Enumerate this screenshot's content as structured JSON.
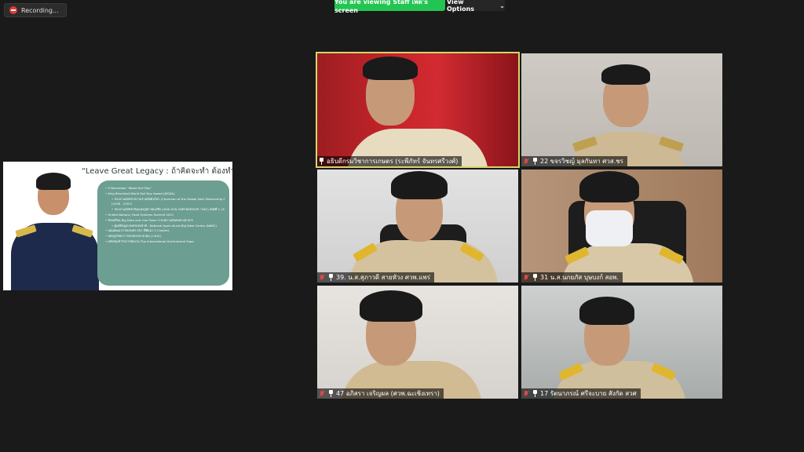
{
  "recording": {
    "label": "Recording..."
  },
  "banner": {
    "viewing": "You are viewing Staff เพ็ด's screen",
    "view_options": "View Options",
    "chevron": "⌄"
  },
  "shared_screen": {
    "title": "“Leave Great Legacy : ถ้าคิดจะทำ ต้องทำให้สุด”",
    "items": [
      "• 5 December \"World Soil Day\"",
      "• King Bhumibol World Soil Day Award (WSDA)",
      "• ประธานสมัชชาความร่วมมือดินโลก (Chairman of the Global Soils Partnership Assembly: FAO/ United Nations)",
      "  (2556 - 2557)",
      "• ประธานสมัชชาดินแห่งภูมิภาคเอเชีย (ASIA SOIL PARTNERSHIP / FAO) สมัยที่ 1 (2556 - 2560) และสมัยที่ 2 (2561 - 2562)",
      "• United Nations, Food Systems Summit 2021",
      "• ขับเคลื่อน Big Data and One Team ระบบความมั่นคงทางอาหาร",
      "  • ศูนย์ข้อมูลเกษตรแห่งชาติ : National Agricultural Big Data Centre (NABC)",
      "• แผนพัฒนาภาคเกษตร EEC ที่มีแนว 5 Clusters",
      "• พลังสูงวิทยาการเกษตรประชาคม (ว.ค.ศ.)",
      "• ผลักดันเข้ารับการจัดงาน The International Horticultural Expo"
    ]
  },
  "participants": [
    {
      "name": "อธิบดีกรมวิชาการเกษตร (ระพีภัทร์ จันทรศรีวงศ์)"
    },
    {
      "name": "22 ขจรวิชญ์ มุลกันหา ศวส.ชร"
    },
    {
      "name": "39. น.ส.สุภาวดี สายหัวง ศวพ.แพร่"
    },
    {
      "name": "31 น.ส.นกยภัส บุษบงก์ สอพ."
    },
    {
      "name": "47 อภิสรา เจริญผล (ศวพ.ฉะเชิงเทรา)"
    },
    {
      "name": "17 รัตนาภรณ์ ศรีจะบาย สังกัด สวศ"
    }
  ],
  "colors": {
    "active_speaker_outline": "#d6d66a",
    "banner_green": "#23c552",
    "muted_mic": "#e24747"
  }
}
